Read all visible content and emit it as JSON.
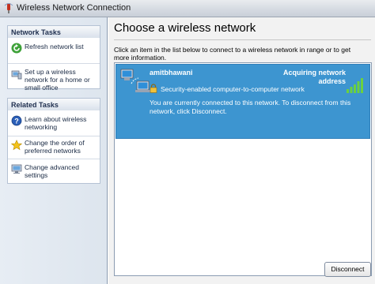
{
  "window": {
    "title": "Wireless Network Connection"
  },
  "sidebar": {
    "network_tasks": {
      "header": "Network Tasks",
      "items": [
        {
          "label": "Refresh network list",
          "icon": "refresh-icon"
        },
        {
          "label": "Set up a wireless network for a home or small office",
          "icon": "setup-network-icon"
        }
      ]
    },
    "related_tasks": {
      "header": "Related Tasks",
      "items": [
        {
          "label": "Learn about wireless networking",
          "icon": "help-icon"
        },
        {
          "label": "Change the order of preferred networks",
          "icon": "star-icon"
        },
        {
          "label": "Change advanced settings",
          "icon": "settings-icon"
        }
      ]
    }
  },
  "main": {
    "title": "Choose a wireless network",
    "instructions": "Click an item in the list below to connect to a wireless network in range or to get more information.",
    "networks": [
      {
        "name": "amitbhawani",
        "status": "Acquiring network address",
        "security": "Security-enabled computer-to-computer network",
        "message": "You are currently connected to this network. To disconnect from this network, click Disconnect.",
        "selected": true
      }
    ],
    "disconnect_label": "Disconnect"
  },
  "colors": {
    "selection": "#3d95d0",
    "pane": "#e3e9f1",
    "signal": "#6bd13f"
  }
}
